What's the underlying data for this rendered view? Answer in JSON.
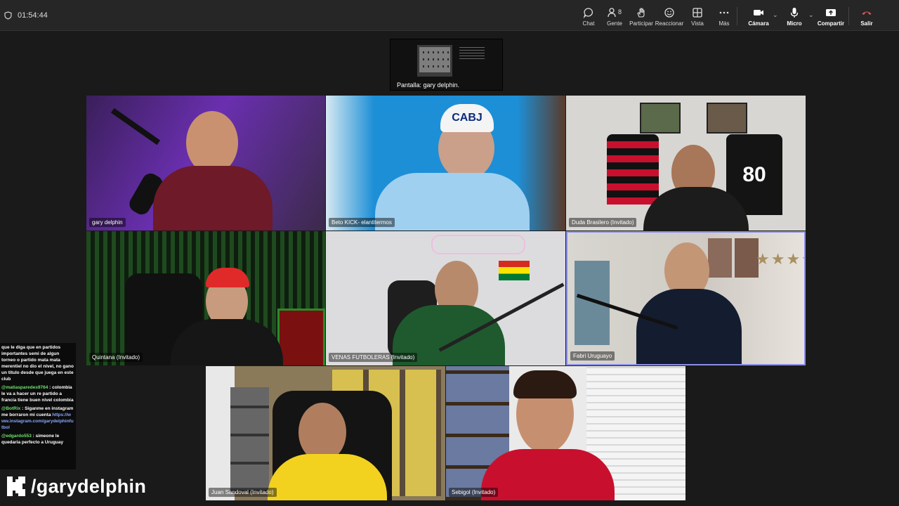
{
  "topbar": {
    "timer": "01:54:44",
    "buttons": [
      {
        "label": "Chat"
      },
      {
        "label": "Gente",
        "badge": "8"
      },
      {
        "label": "Participar"
      },
      {
        "label": "Reaccionar"
      },
      {
        "label": "Vista"
      },
      {
        "label": "Más"
      },
      {
        "label": "Cámara"
      },
      {
        "label": "Micro"
      },
      {
        "label": "Compartir"
      },
      {
        "label": "Salir"
      }
    ]
  },
  "screen_share": {
    "label": "Pantalla: gary delphin."
  },
  "participants": [
    {
      "name": "gary delphin"
    },
    {
      "name": "Beto KICK- elantitermos"
    },
    {
      "name": "Duda Brasilero (Invitado)"
    },
    {
      "name": "Quintana (Invitado)"
    },
    {
      "name": "VENAS FUTBOLERAS (Invitado)"
    },
    {
      "name": "Fabri Uruguayo"
    },
    {
      "name": "Juan Sandoval (Invitado)"
    },
    {
      "name": "Sebigol (Invitado)"
    }
  ],
  "chat": [
    {
      "user": "",
      "text": "que le diga que en partidos importantes semi de algun torneo o partido mata mata merentiel no dio el nivel, no gano un titulo desde que juega en este club"
    },
    {
      "user": "@matiasparedes9764",
      "text": ": colombia le va a hacer un re partido a francia tiene buen nivel colombia"
    },
    {
      "user": "@BotRix",
      "text": ": Siganme en instagram me borraron mi cuenta",
      "link": "https://www.instagram.com/garydelphinfutbol"
    },
    {
      "user": "@edgardo553",
      "text": ": simeone le quedaria perfecto a Uruguay"
    }
  ],
  "watermark": {
    "text": "/garydelphin"
  },
  "colors": {
    "topbar": "#262626",
    "background": "#1a1a1a",
    "active_speaker_border": "#8b8ee8",
    "leave": "#e05a5a",
    "chat_user": "#6ee36e"
  }
}
